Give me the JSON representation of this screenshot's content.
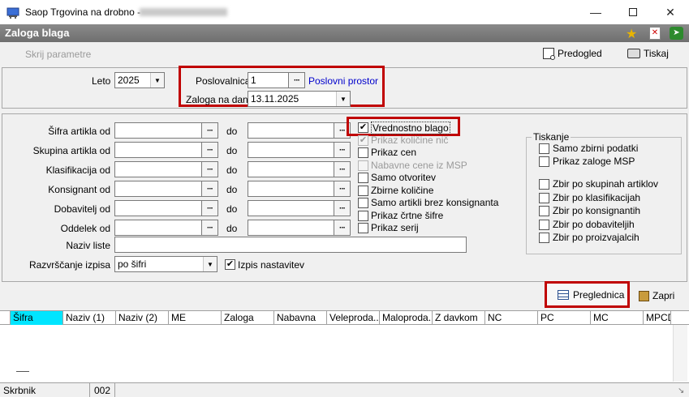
{
  "window": {
    "title": "Saop Trgovina na drobno -"
  },
  "band": {
    "title": "Zaloga blaga"
  },
  "toolbar": {
    "hide_params": "Skrij parametre",
    "preview": "Predogled",
    "print": "Tiskaj"
  },
  "top": {
    "year_label": "Leto",
    "year_value": "2025",
    "branch_label": "Poslovalnica",
    "branch_value": "1",
    "branch_link": "Poslovni prostor",
    "stock_date_label": "Zaloga na dan",
    "stock_date_value": "13.11.2025"
  },
  "filters": {
    "rows": [
      {
        "label": "Šifra artikla od",
        "to": "do"
      },
      {
        "label": "Skupina artikla od",
        "to": "do"
      },
      {
        "label": "Klasifikacija od",
        "to": "do"
      },
      {
        "label": "Konsignant od",
        "to": "do"
      },
      {
        "label": "Dobavitelj od",
        "to": "do"
      },
      {
        "label": "Oddelek od",
        "to": "do"
      }
    ],
    "list_name_label": "Naziv liste",
    "sort_label": "Razvrščanje izpisa",
    "sort_value": "po šifri",
    "settings_label": "Izpis nastavitev"
  },
  "options": [
    {
      "label": "Vrednostno blago",
      "checked": true,
      "disabled": false
    },
    {
      "label": "Prikaz količine nič",
      "checked": true,
      "disabled": true
    },
    {
      "label": "Prikaz cen",
      "checked": false,
      "disabled": false
    },
    {
      "label": "Nabavne cene iz MSP",
      "checked": false,
      "disabled": true
    },
    {
      "label": "Samo otvoritev",
      "checked": false,
      "disabled": false
    },
    {
      "label": "Zbirne količine",
      "checked": false,
      "disabled": false
    },
    {
      "label": "Samo artikli brez konsignanta",
      "checked": false,
      "disabled": false
    },
    {
      "label": "Prikaz črtne šifre",
      "checked": false,
      "disabled": false
    },
    {
      "label": "Prikaz serij",
      "checked": false,
      "disabled": false
    }
  ],
  "printing": {
    "legend": "Tiskanje",
    "group1": [
      "Samo zbirni podatki",
      "Prikaz zaloge MSP"
    ],
    "group2": [
      "Zbir po skupinah artiklov",
      "Zbir po klasifikacijah",
      "Zbir po konsignantih",
      "Zbir po dobaviteljih",
      "Zbir po proizvajalcih"
    ]
  },
  "actions": {
    "grid": "Preglednica",
    "close": "Zapri"
  },
  "grid": {
    "columns": [
      "Šifra",
      "Naziv (1)",
      "Naziv (2)",
      "ME",
      "Zaloga",
      "Nabavna",
      "Veleproda...",
      "Maloproda...",
      "Z davkom",
      "NC",
      "PC",
      "MC",
      "MPCD"
    ]
  },
  "status": {
    "user": "Skrbnik",
    "code": "002"
  },
  "colors": {
    "red_highlight": "#c00000",
    "band": "#7a7a7a",
    "selected_col": "#00e5ff",
    "link": "#0000cc"
  }
}
